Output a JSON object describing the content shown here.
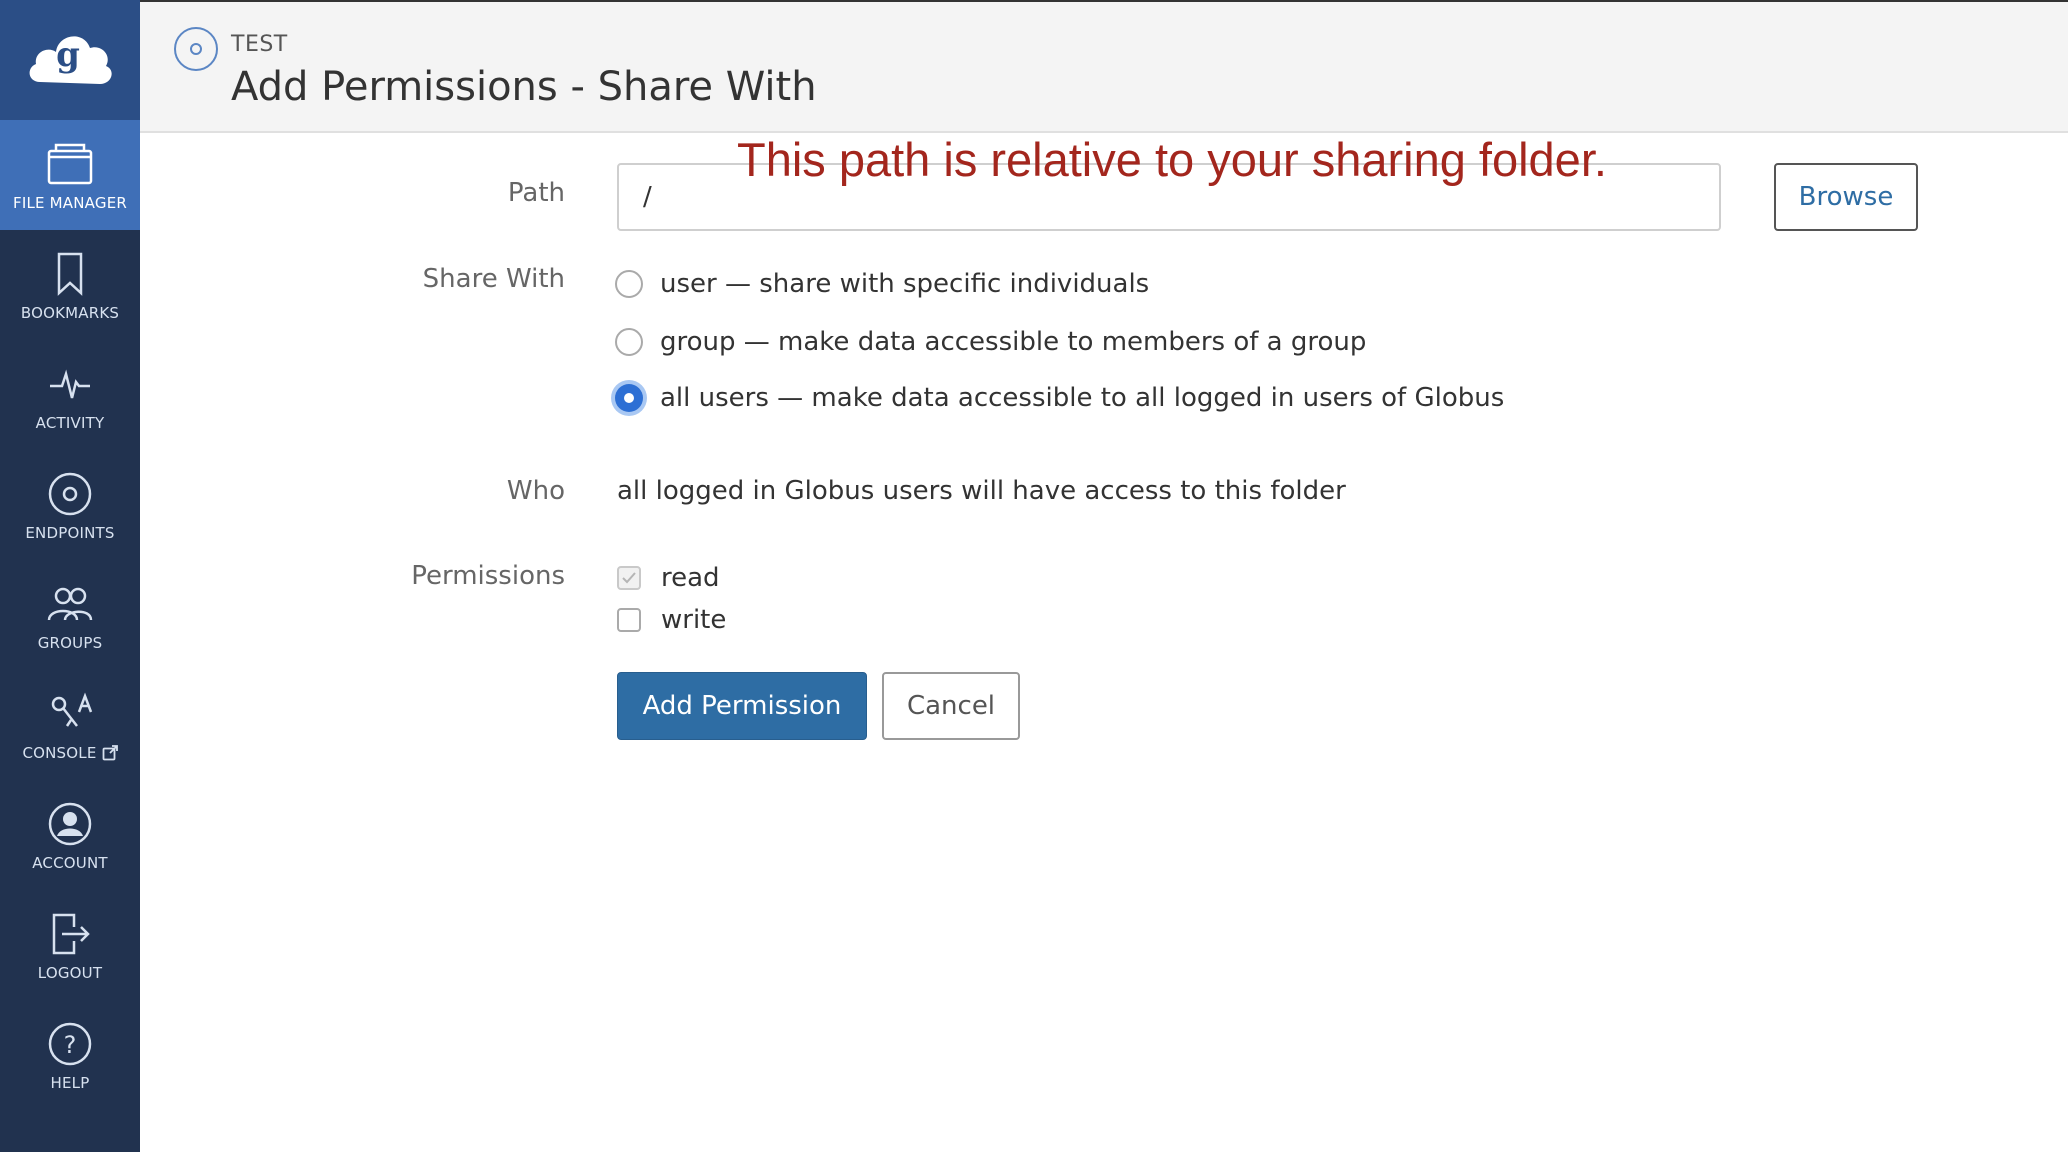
{
  "sidebar": {
    "logo_icon": "globus-cloud-logo",
    "items": [
      {
        "label": "FILE MANAGER",
        "icon": "folder-icon",
        "active": true
      },
      {
        "label": "BOOKMARKS",
        "icon": "bookmark-icon"
      },
      {
        "label": "ACTIVITY",
        "icon": "activity-pulse-icon"
      },
      {
        "label": "ENDPOINTS",
        "icon": "endpoint-icon"
      },
      {
        "label": "GROUPS",
        "icon": "groups-icon"
      },
      {
        "label": "CONSOLE",
        "icon": "console-icon",
        "external_icon": "external-link-icon"
      },
      {
        "label": "ACCOUNT",
        "icon": "account-icon"
      },
      {
        "label": "LOGOUT",
        "icon": "logout-icon"
      },
      {
        "label": "HELP",
        "icon": "help-icon"
      }
    ]
  },
  "header": {
    "endpoint_name": "TEST",
    "title": "Add Permissions - Share With"
  },
  "annotation": "This path is relative to your sharing folder.",
  "form": {
    "path": {
      "label": "Path",
      "value": "/"
    },
    "browse_label": "Browse",
    "share_with": {
      "label": "Share With",
      "options": [
        {
          "text": "user — share with specific individuals",
          "selected": false
        },
        {
          "text": "group — make data accessible to members of a group",
          "selected": false
        },
        {
          "text": "all users — make data accessible to all logged in users of Globus",
          "selected": true
        }
      ]
    },
    "who": {
      "label": "Who",
      "text": "all logged in Globus users will have access to this folder"
    },
    "permissions": {
      "label": "Permissions",
      "options": [
        {
          "text": "read",
          "checked": true
        },
        {
          "text": "write",
          "checked": false
        }
      ]
    },
    "add_permission_label": "Add Permission",
    "cancel_label": "Cancel"
  },
  "colors": {
    "sidebar_bg": "#21324f",
    "sidebar_active": "#3f6fb7",
    "primary": "#2e6da4",
    "annotation": "#a3261d"
  }
}
